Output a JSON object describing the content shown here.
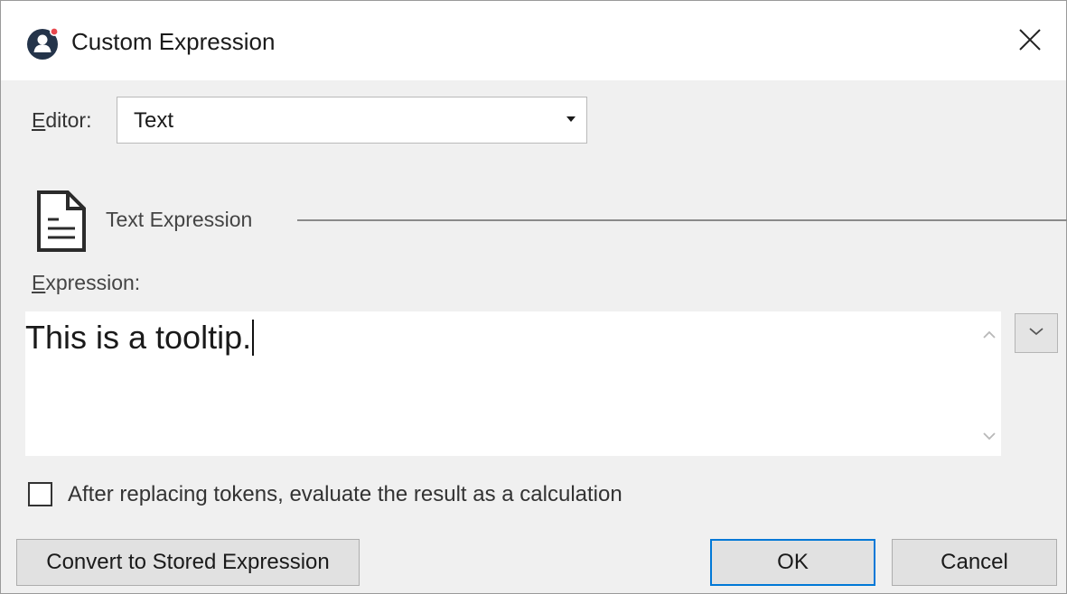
{
  "window": {
    "title": "Custom Expression"
  },
  "editor": {
    "label_mnemonic": "E",
    "label_rest": "ditor:",
    "selected": "Text"
  },
  "section": {
    "title": "Text Expression"
  },
  "expression": {
    "label_mnemonic": "E",
    "label_rest": "xpression:",
    "value": "This is a tooltip."
  },
  "options": {
    "evaluate_label": "After replacing tokens, evaluate the result as a calculation",
    "evaluate_checked": false
  },
  "buttons": {
    "convert": "Convert to Stored Expression",
    "ok": "OK",
    "cancel": "Cancel"
  },
  "icons": {
    "app": "app-person-icon",
    "close": "close-icon",
    "document": "document-icon",
    "dropdown": "dropdown-arrow-icon",
    "scroll_up": "chevron-up-icon",
    "scroll_down": "chevron-down-icon",
    "expand": "chevron-down-icon"
  },
  "colors": {
    "app_icon": "#24344a",
    "app_badge": "#e8484e",
    "focus_border": "#0078d7"
  }
}
